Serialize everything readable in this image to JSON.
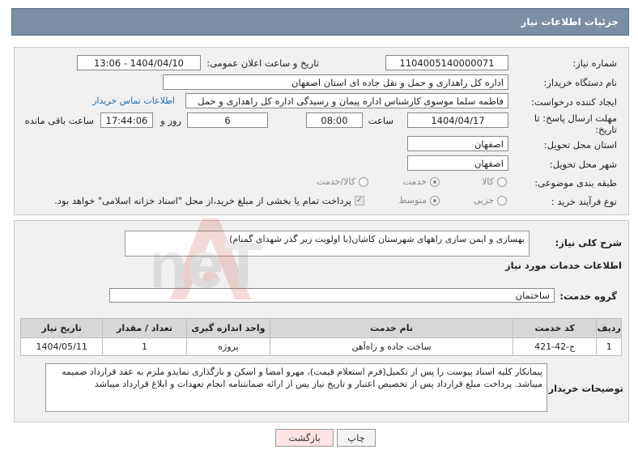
{
  "header": {
    "title": "جزئیات اطلاعات نیاز"
  },
  "form": {
    "need_number_label": "شماره نیاز:",
    "need_number": "1104005140000071",
    "announce_label": "تاریخ و ساعت اعلان عمومی:",
    "announce_value": "1404/04/10 - 13:06",
    "buyer_org_label": "نام دستگاه خریدار:",
    "buyer_org": "اداره کل راهداری و حمل و نقل جاده ای استان اصفهان",
    "requester_label": "ایجاد کننده درخواست:",
    "requester": "فاطمه سلما موسوی کارشناس اداره پیمان و رسیدگی اداره کل راهداری و حمل",
    "contact_link": "اطلاعات تماس خریدار",
    "deadline_label": "مهلت ارسال پاسخ: تا تاریخ:",
    "deadline_date": "1404/04/17",
    "time_label": "ساعت",
    "deadline_time": "08:00",
    "days_value": "6",
    "days_label": "روز و",
    "remaining_time": "17:44:06",
    "remaining_label": "ساعت باقی مانده",
    "delivery_province_label": "استان محل تحویل:",
    "delivery_province": "اصفهان",
    "delivery_city_label": "شهر محل تحویل:",
    "delivery_city": "اصفهان",
    "category_label": "طبقه بندی موضوعی:",
    "category_options": [
      "کالا",
      "خدمت",
      "کالا/خدمت"
    ],
    "category_selected": "خدمت",
    "process_label": "نوع فرآیند خرید :",
    "process_options": [
      "جزیی",
      "متوسط"
    ],
    "process_selected": "متوسط",
    "payment_note": "پرداخت تمام یا بخشی از مبلغ خرید،از محل \"اسناد خزانه اسلامی\" خواهد بود."
  },
  "summary": {
    "label": "شرح کلی نیاز:",
    "text": "بهسازی و ایمن سازی راههای شهرستان کاشان(با اولویت زیر گذر شهدای گمنام)"
  },
  "services": {
    "section_title": "اطلاعات خدمات مورد نیاز",
    "group_label": "گروه خدمت:",
    "group_value": "ساختمان",
    "columns": [
      "ردیف",
      "کد خدمت",
      "نام خدمت",
      "واحد اندازه گیری",
      "تعداد / مقدار",
      "تاریخ نیاز"
    ],
    "rows": [
      [
        "1",
        "ج-42-421",
        "ساخت جاده و راه‌آهن",
        "پروژه",
        "1",
        "1404/05/11"
      ]
    ]
  },
  "notes": {
    "label": "توضیحات خریدار:",
    "text": "پیمانکار کلیه اسناد پیوست را پس از تکمیل(فرم استعلام قیمت)، مهرو امضا و اسکن و بارگذاری نمایدو ملزم به عقد قرارداد ضمیمه میباشد. پرداخت مبلغ قرارداد پس از تخصیص اعتبار و تاریخ نیاز پس از ارائه ضمانتنامه انجام تعهدات و ابلاغ قرارداد میباشد"
  },
  "buttons": {
    "print": "چاپ",
    "back": "بازگشت"
  },
  "watermark": {
    "text": "AriaTender.neT"
  },
  "colors": {
    "header_bg": "#7a8ea5",
    "panel_bg": "#f0f0f0",
    "link": "#1f6fb2",
    "back_btn": "#fde3e3"
  }
}
